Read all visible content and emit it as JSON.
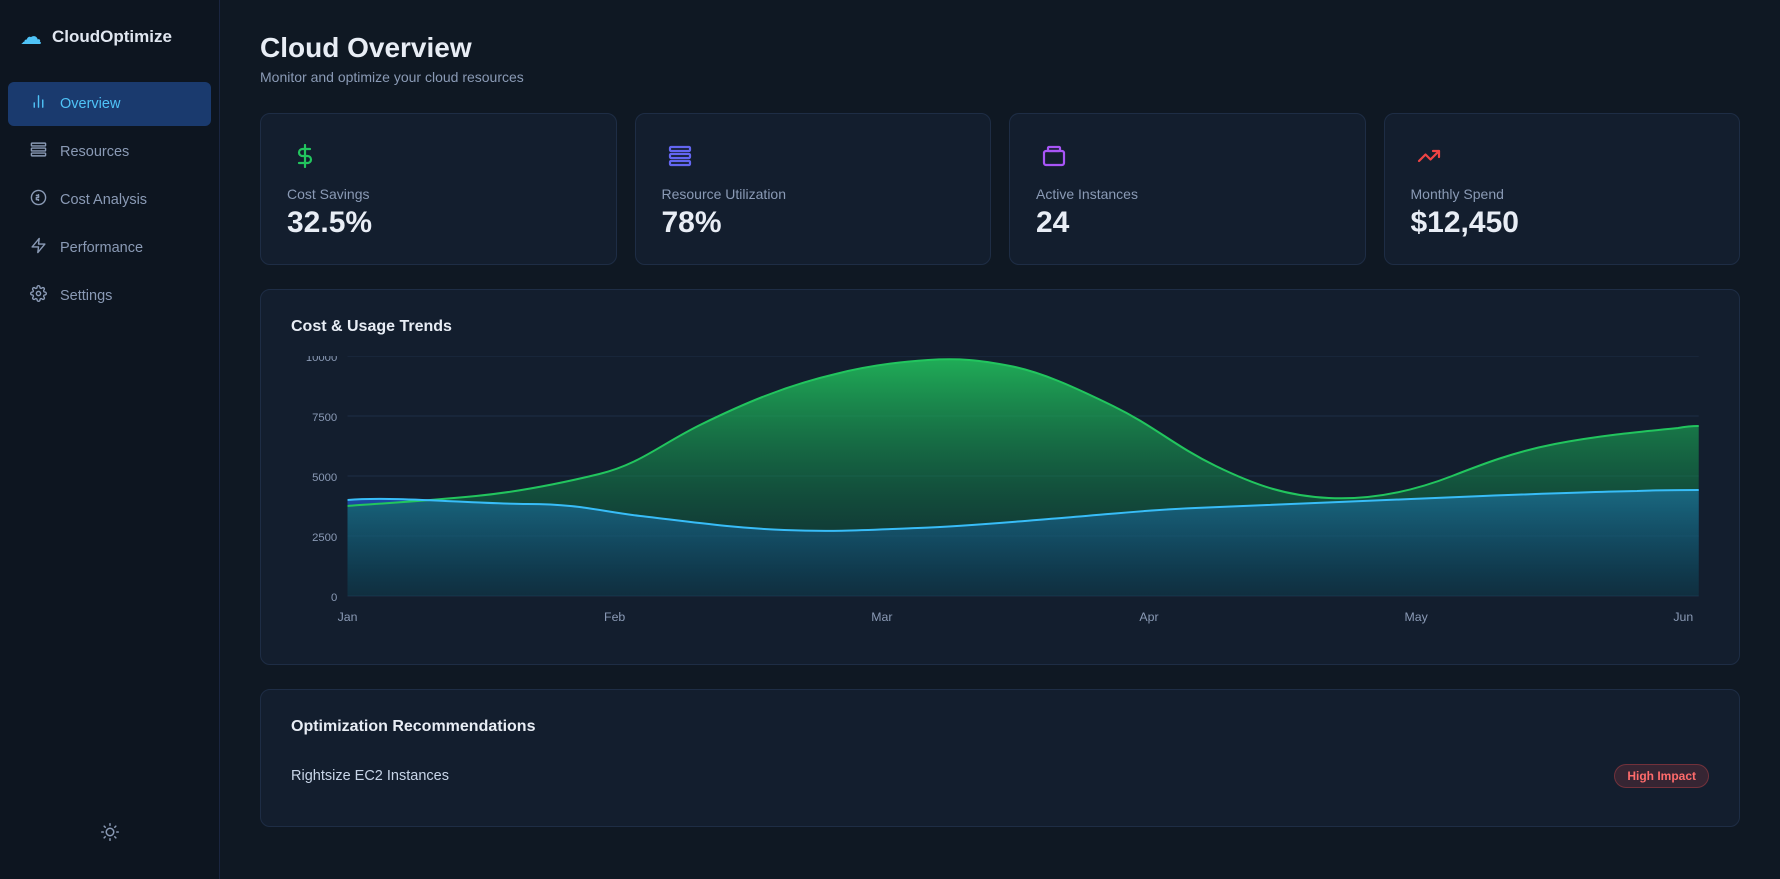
{
  "app": {
    "name": "CloudOptimize",
    "logo_icon": "☁"
  },
  "sidebar": {
    "items": [
      {
        "id": "overview",
        "label": "Overview",
        "icon": "📊",
        "active": true
      },
      {
        "id": "resources",
        "label": "Resources",
        "icon": "🗄"
      },
      {
        "id": "cost-analysis",
        "label": "Cost Analysis",
        "icon": "💲"
      },
      {
        "id": "performance",
        "label": "Performance",
        "icon": "⚡"
      },
      {
        "id": "settings",
        "label": "Settings",
        "icon": "⚙"
      }
    ],
    "bottom_icon": "☀"
  },
  "page": {
    "title": "Cloud Overview",
    "subtitle": "Monitor and optimize your cloud resources"
  },
  "stats": [
    {
      "id": "cost-savings",
      "label": "Cost Savings",
      "value": "32.5%",
      "icon_color": "#22c55e",
      "icon": "$"
    },
    {
      "id": "resource-utilization",
      "label": "Resource Utilization",
      "value": "78%",
      "icon_color": "#6366f1",
      "icon": "▦"
    },
    {
      "id": "active-instances",
      "label": "Active Instances",
      "value": "24",
      "icon_color": "#a855f7",
      "icon": "▬"
    },
    {
      "id": "monthly-spend",
      "label": "Monthly Spend",
      "value": "$12,450",
      "icon_color": "#ef4444",
      "icon": "↗"
    }
  ],
  "chart": {
    "title": "Cost & Usage Trends",
    "y_labels": [
      "10000",
      "7500",
      "5000",
      "2500",
      "0"
    ],
    "x_labels": [
      "Jan",
      "Feb",
      "Mar",
      "Apr",
      "May",
      "Jun"
    ],
    "colors": {
      "area1_top": "#22d3ee",
      "area1_bottom": "#0e4a8a",
      "area2_top": "#22c55e",
      "area2_bottom": "#064e3b"
    }
  },
  "recommendations": {
    "title": "Optimization Recommendations",
    "items": [
      {
        "name": "Rightsize EC2 Instances",
        "badge": "High Impact",
        "badge_type": "high"
      }
    ]
  }
}
